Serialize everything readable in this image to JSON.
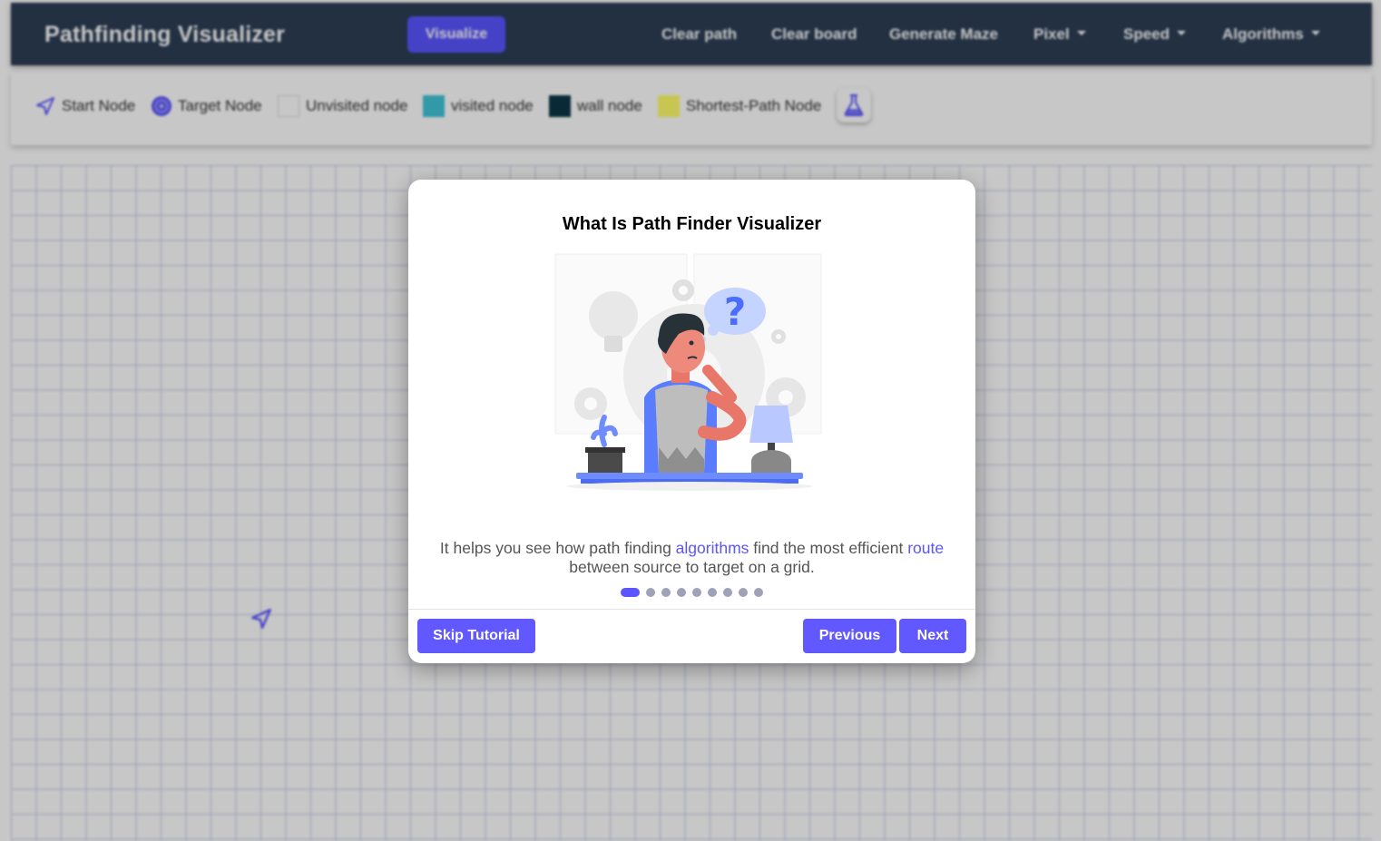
{
  "navbar": {
    "brand": "Pathfinding Visualizer",
    "visualize_label": "Visualize",
    "links": {
      "clear_path": "Clear path",
      "clear_board": "Clear board",
      "generate_maze": "Generate Maze",
      "pixel": "Pixel",
      "speed": "Speed",
      "algorithms": "Algorithms"
    }
  },
  "legend": {
    "start": "Start Node",
    "target": "Target Node",
    "unvisited": "Unvisited node",
    "visited": "visited node",
    "wall": "wall node",
    "shortest": "Shortest-Path Node"
  },
  "icons": {
    "start": "paper-plane-icon",
    "target": "target-icon",
    "flask": "flask-icon"
  },
  "colors": {
    "accent": "#5a55ff",
    "navbar": "#2c3e55",
    "unvisited": "#ffffff",
    "visited": "#40c4d8",
    "wall": "#0c3546",
    "shortest": "#fffe6a"
  },
  "modal": {
    "title": "What Is Path Finder Visualizer",
    "text_part1": "It helps you see how path finding ",
    "text_highlight1": "algorithms",
    "text_part2": " find the most efficient ",
    "text_highlight2": "route",
    "text_part3": " between source to target on a grid.",
    "page_current": 1,
    "page_total": 9,
    "skip_label": "Skip Tutorial",
    "previous_label": "Previous",
    "next_label": "Next"
  }
}
